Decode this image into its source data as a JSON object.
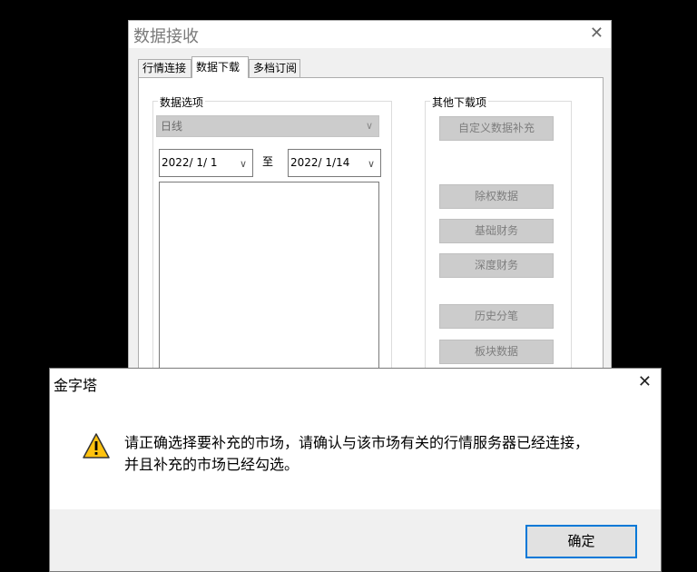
{
  "main_window": {
    "title": "数据接收",
    "tabs": [
      {
        "label": "行情连接"
      },
      {
        "label": "数据下载"
      },
      {
        "label": "多档订阅"
      }
    ],
    "data_options": {
      "group_label": "数据选项",
      "period_value": "日线",
      "start_date": "2022/ 1/ 1",
      "to_label": "至",
      "end_date": "2022/ 1/14"
    },
    "other_downloads": {
      "group_label": "其他下载项",
      "buttons": [
        {
          "label": "自定义数据补充"
        },
        {
          "label": "除权数据"
        },
        {
          "label": "基础财务"
        },
        {
          "label": "深度财务"
        },
        {
          "label": "历史分笔"
        },
        {
          "label": "板块数据"
        }
      ]
    }
  },
  "dialog": {
    "title": "金字塔",
    "message_line1": "请正确选择要补充的市场，请确认与该市场有关的行情服务器已经连接，",
    "message_line2": "并且补充的市场已经勾选。",
    "ok_label": "确定"
  },
  "icons": {
    "close": "close-icon",
    "warning": "warning-icon",
    "dropdown": "chevron-down-icon"
  },
  "colors": {
    "accent": "#0078d7",
    "warning": "#ffc20e"
  }
}
